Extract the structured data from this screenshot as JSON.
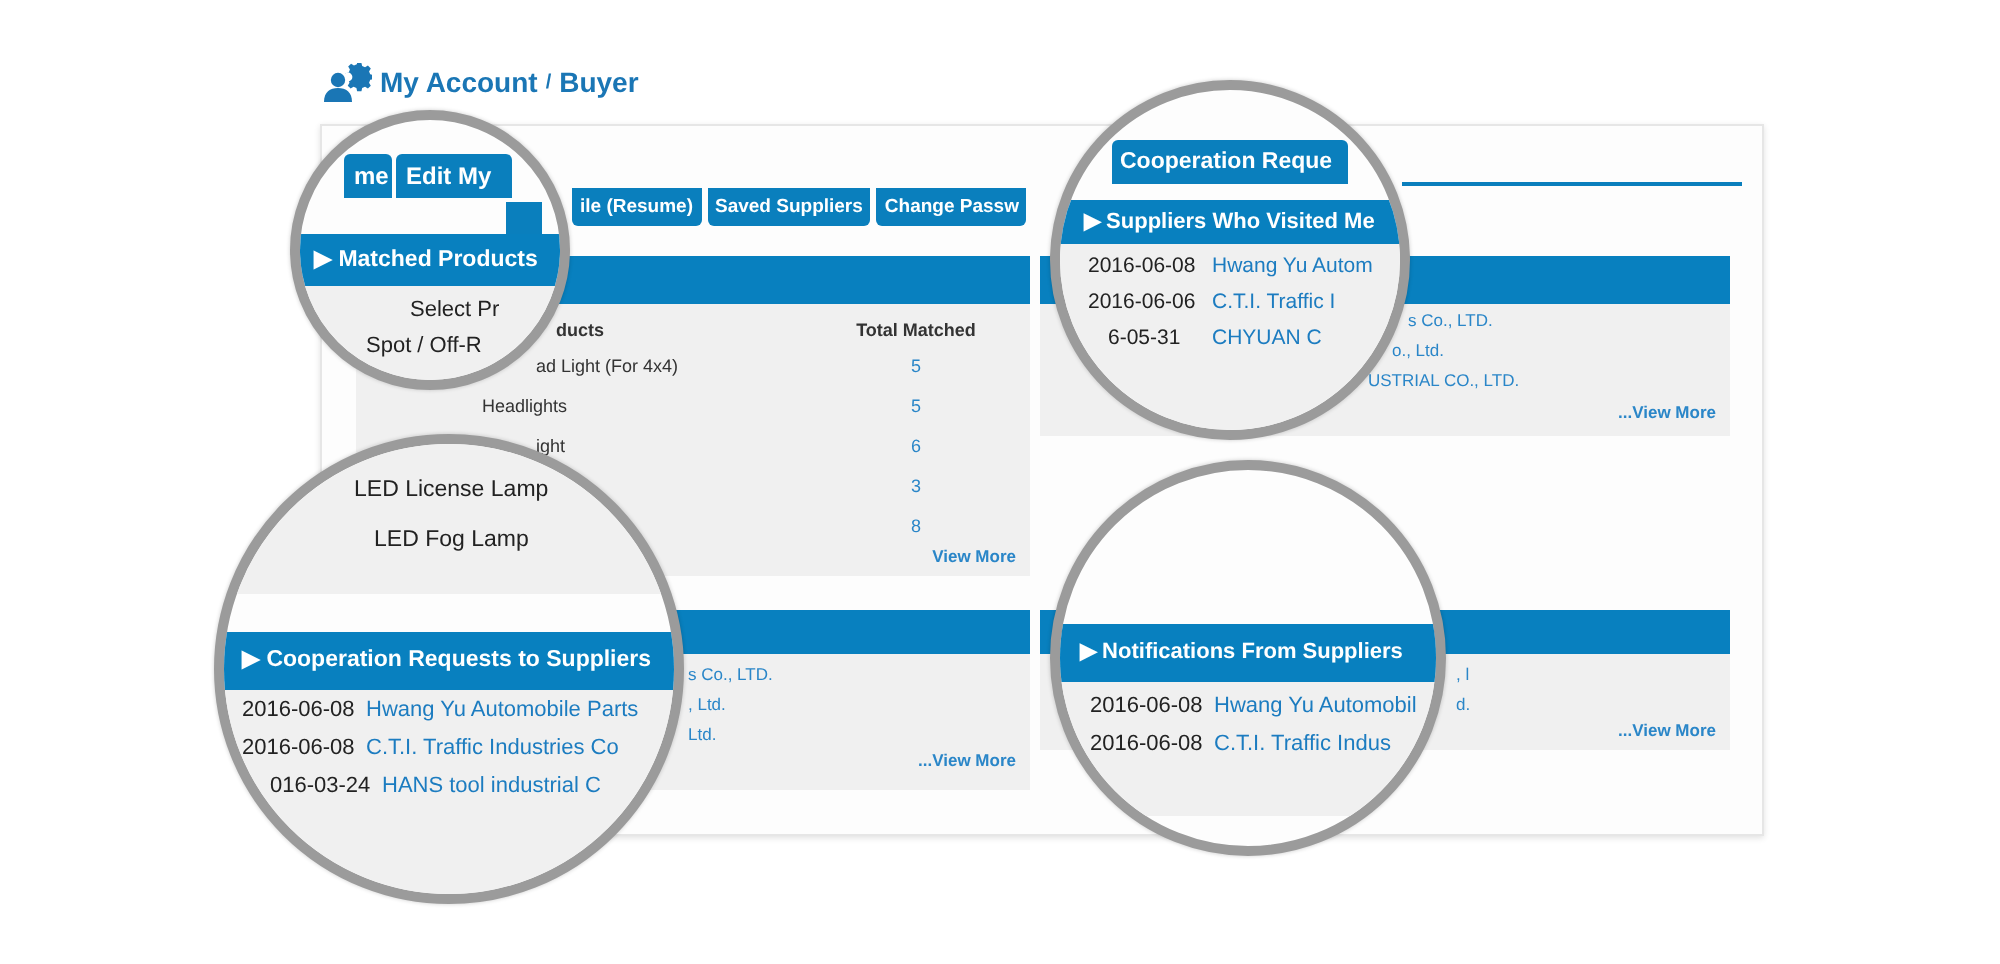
{
  "header": {
    "title": "My Account",
    "separator": "/",
    "role": "Buyer"
  },
  "sub_tabs": [
    {
      "label": "ile (Resume)"
    },
    {
      "label": "Saved Suppliers"
    },
    {
      "label": "Change Passw"
    }
  ],
  "matched_products": {
    "columns": [
      "ducts",
      "Total Matched"
    ],
    "rows": [
      {
        "product": "ad Light (For 4x4)",
        "total": "5"
      },
      {
        "product": "Headlights",
        "total": "5"
      },
      {
        "product": "ight",
        "total": "6"
      },
      {
        "total": "3"
      },
      {
        "total": "8"
      }
    ],
    "view_more": "View More"
  },
  "suppliers_who_visited": {
    "rows": [
      "s Co., LTD.",
      "o., Ltd.",
      "USTRIAL CO., LTD."
    ],
    "view_more": "...View More"
  },
  "cooperation_requests": {
    "rows": [
      "s Co., LTD.",
      ", Ltd.",
      "Ltd."
    ],
    "view_more": "...View More"
  },
  "notifications": {
    "rows": [
      ", l",
      "d."
    ],
    "view_more": "...View More"
  },
  "magnifiers": [
    {
      "tabs": [
        "me",
        "Edit My"
      ],
      "header": "▶ Matched Products",
      "lines": [
        "Select Pr",
        "Spot / Off-R"
      ]
    },
    {
      "tabs": [
        "Cooperation Reque"
      ],
      "header": "▶ Suppliers Who Visited Me",
      "rows": [
        {
          "date": "2016-06-08",
          "company": "Hwang Yu Autom"
        },
        {
          "date": "2016-06-06",
          "company": "C.T.I. Traffic I"
        },
        {
          "date": "6-05-31",
          "company": "CHYUAN C"
        }
      ]
    },
    {
      "lines_above": [
        "LED License Lamp",
        "LED Fog Lamp"
      ],
      "header": "▶ Cooperation Requests to Suppliers",
      "rows": [
        {
          "date": "2016-06-08",
          "company": "Hwang Yu Automobile Parts"
        },
        {
          "date": "2016-06-08",
          "company": "C.T.I. Traffic Industries Co"
        },
        {
          "date": "016-03-24",
          "company": "HANS tool industrial C"
        }
      ]
    },
    {
      "header": "▶ Notifications From Suppliers",
      "rows": [
        {
          "date": "2016-06-08",
          "company": "Hwang Yu Automobil"
        },
        {
          "date": "2016-06-08",
          "company": "C.T.I. Traffic Indus"
        }
      ]
    }
  ]
}
